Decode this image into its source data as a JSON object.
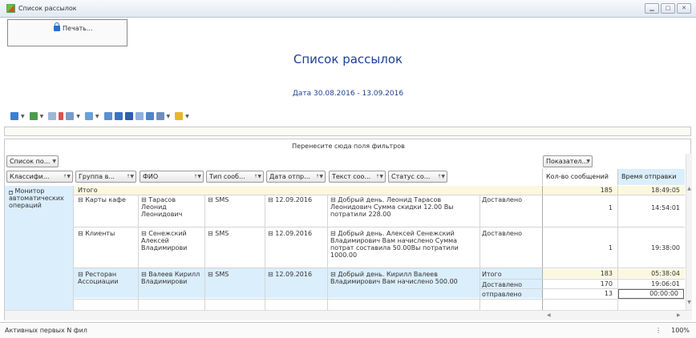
{
  "window": {
    "title": "Список рассылок"
  },
  "toolbar": {
    "print_label": "Печать..."
  },
  "report": {
    "title": "Список рассылок",
    "date": "Дата 30.08.2016 - 13.09.2016"
  },
  "pivot": {
    "filter_hint": "Перенесите сюда поля фильтров",
    "column_field": "Список по...",
    "data_field": "Показател...",
    "row_fields": [
      "Классифи...",
      "Группа в...",
      "ФИО",
      "Тип сооб...",
      "Дата отпр...",
      "Текст соо...",
      "Статус со..."
    ],
    "data_headers": [
      "Кол-во сообщений",
      "Время отправки"
    ],
    "category": "Монитор автоматических операций",
    "total_label": "Итого",
    "total_count": "185",
    "total_time": "18:49:05",
    "rows": [
      {
        "group": "Карты кафе",
        "fio": "Тарасов Леонид Леонидович",
        "type": "SMS",
        "date": "12.09.2016",
        "text": "Добрый день. Леонид Тарасов Леонидович Сумма скидки 12.00 Вы потратили 228.00",
        "status": "Доставлено",
        "count": "1",
        "time": "14:54:01"
      },
      {
        "group": "Клиенты",
        "fio": "Сенежский Алексей Владимирови",
        "type": "SMS",
        "date": "12.09.2016",
        "text": "Добрый день. Алексей Сенежский Владимирович Вам начислено Сумма потрат составила 50.00Вы потратили 1000.00",
        "status": "Доставлено",
        "count": "1",
        "time": "19:38:00"
      },
      {
        "group": "Ресторан Ассоциации",
        "fio": "Валеев Кирилл Владимирови",
        "type": "SMS",
        "date": "12.09.2016",
        "text": "Добрый день. Кирилл Валеев Владимирович Вам начислено 500.00",
        "subrows": [
          {
            "status": "Итого",
            "count": "183",
            "time": "05:38:04"
          },
          {
            "status": "Доставлено",
            "count": "170",
            "time": "19:06:01"
          },
          {
            "status": "отправлено",
            "count": "13",
            "time": "00:00:00"
          }
        ]
      }
    ]
  },
  "status": {
    "left": "Активных первых N фил",
    "zoom": "100%"
  },
  "colors": {
    "title": "#1c3f94",
    "highlight": "#dbeefc",
    "total_bg": "#fcf8df"
  }
}
